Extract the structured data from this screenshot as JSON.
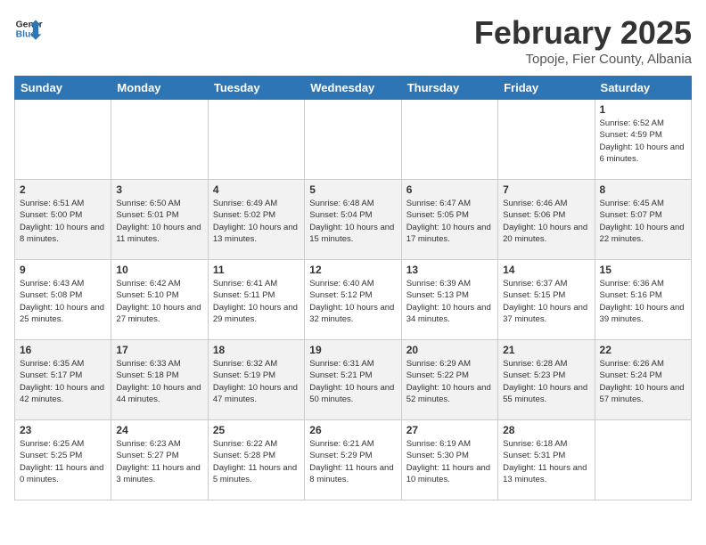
{
  "header": {
    "logo_line1": "General",
    "logo_line2": "Blue",
    "title": "February 2025",
    "subtitle": "Topoje, Fier County, Albania"
  },
  "weekdays": [
    "Sunday",
    "Monday",
    "Tuesday",
    "Wednesday",
    "Thursday",
    "Friday",
    "Saturday"
  ],
  "weeks": [
    [
      {
        "day": "",
        "info": ""
      },
      {
        "day": "",
        "info": ""
      },
      {
        "day": "",
        "info": ""
      },
      {
        "day": "",
        "info": ""
      },
      {
        "day": "",
        "info": ""
      },
      {
        "day": "",
        "info": ""
      },
      {
        "day": "1",
        "info": "Sunrise: 6:52 AM\nSunset: 4:59 PM\nDaylight: 10 hours and 6 minutes."
      }
    ],
    [
      {
        "day": "2",
        "info": "Sunrise: 6:51 AM\nSunset: 5:00 PM\nDaylight: 10 hours and 8 minutes."
      },
      {
        "day": "3",
        "info": "Sunrise: 6:50 AM\nSunset: 5:01 PM\nDaylight: 10 hours and 11 minutes."
      },
      {
        "day": "4",
        "info": "Sunrise: 6:49 AM\nSunset: 5:02 PM\nDaylight: 10 hours and 13 minutes."
      },
      {
        "day": "5",
        "info": "Sunrise: 6:48 AM\nSunset: 5:04 PM\nDaylight: 10 hours and 15 minutes."
      },
      {
        "day": "6",
        "info": "Sunrise: 6:47 AM\nSunset: 5:05 PM\nDaylight: 10 hours and 17 minutes."
      },
      {
        "day": "7",
        "info": "Sunrise: 6:46 AM\nSunset: 5:06 PM\nDaylight: 10 hours and 20 minutes."
      },
      {
        "day": "8",
        "info": "Sunrise: 6:45 AM\nSunset: 5:07 PM\nDaylight: 10 hours and 22 minutes."
      }
    ],
    [
      {
        "day": "9",
        "info": "Sunrise: 6:43 AM\nSunset: 5:08 PM\nDaylight: 10 hours and 25 minutes."
      },
      {
        "day": "10",
        "info": "Sunrise: 6:42 AM\nSunset: 5:10 PM\nDaylight: 10 hours and 27 minutes."
      },
      {
        "day": "11",
        "info": "Sunrise: 6:41 AM\nSunset: 5:11 PM\nDaylight: 10 hours and 29 minutes."
      },
      {
        "day": "12",
        "info": "Sunrise: 6:40 AM\nSunset: 5:12 PM\nDaylight: 10 hours and 32 minutes."
      },
      {
        "day": "13",
        "info": "Sunrise: 6:39 AM\nSunset: 5:13 PM\nDaylight: 10 hours and 34 minutes."
      },
      {
        "day": "14",
        "info": "Sunrise: 6:37 AM\nSunset: 5:15 PM\nDaylight: 10 hours and 37 minutes."
      },
      {
        "day": "15",
        "info": "Sunrise: 6:36 AM\nSunset: 5:16 PM\nDaylight: 10 hours and 39 minutes."
      }
    ],
    [
      {
        "day": "16",
        "info": "Sunrise: 6:35 AM\nSunset: 5:17 PM\nDaylight: 10 hours and 42 minutes."
      },
      {
        "day": "17",
        "info": "Sunrise: 6:33 AM\nSunset: 5:18 PM\nDaylight: 10 hours and 44 minutes."
      },
      {
        "day": "18",
        "info": "Sunrise: 6:32 AM\nSunset: 5:19 PM\nDaylight: 10 hours and 47 minutes."
      },
      {
        "day": "19",
        "info": "Sunrise: 6:31 AM\nSunset: 5:21 PM\nDaylight: 10 hours and 50 minutes."
      },
      {
        "day": "20",
        "info": "Sunrise: 6:29 AM\nSunset: 5:22 PM\nDaylight: 10 hours and 52 minutes."
      },
      {
        "day": "21",
        "info": "Sunrise: 6:28 AM\nSunset: 5:23 PM\nDaylight: 10 hours and 55 minutes."
      },
      {
        "day": "22",
        "info": "Sunrise: 6:26 AM\nSunset: 5:24 PM\nDaylight: 10 hours and 57 minutes."
      }
    ],
    [
      {
        "day": "23",
        "info": "Sunrise: 6:25 AM\nSunset: 5:25 PM\nDaylight: 11 hours and 0 minutes."
      },
      {
        "day": "24",
        "info": "Sunrise: 6:23 AM\nSunset: 5:27 PM\nDaylight: 11 hours and 3 minutes."
      },
      {
        "day": "25",
        "info": "Sunrise: 6:22 AM\nSunset: 5:28 PM\nDaylight: 11 hours and 5 minutes."
      },
      {
        "day": "26",
        "info": "Sunrise: 6:21 AM\nSunset: 5:29 PM\nDaylight: 11 hours and 8 minutes."
      },
      {
        "day": "27",
        "info": "Sunrise: 6:19 AM\nSunset: 5:30 PM\nDaylight: 11 hours and 10 minutes."
      },
      {
        "day": "28",
        "info": "Sunrise: 6:18 AM\nSunset: 5:31 PM\nDaylight: 11 hours and 13 minutes."
      },
      {
        "day": "",
        "info": ""
      }
    ]
  ]
}
